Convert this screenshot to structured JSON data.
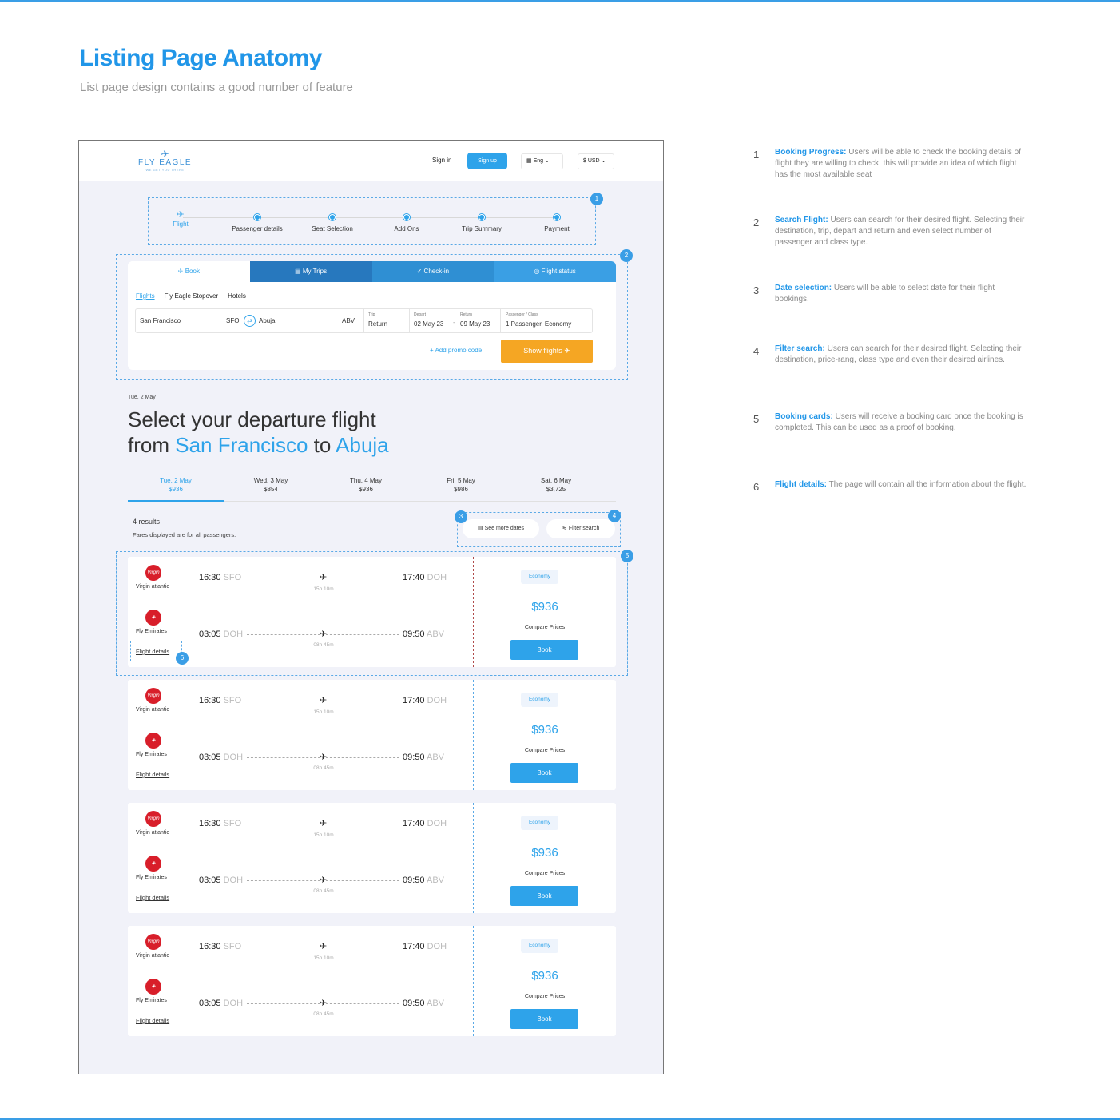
{
  "header": {
    "title": "Listing Page Anatomy",
    "subtitle": "List page design contains a good number of feature"
  },
  "nav": {
    "brand": "FLY EAGLE",
    "tagline": "WE GET YOU THERE",
    "sign_in": "Sign in",
    "sign_up": "Sign up",
    "language": "Eng",
    "currency": "$ USD"
  },
  "progress": {
    "steps": [
      "Flight",
      "Passenger details",
      "Seat Selection",
      "Add Ons",
      "Trip Summary",
      "Payment"
    ]
  },
  "search": {
    "tabs": [
      "Book",
      "My Trips",
      "Check-in",
      "Flight status"
    ],
    "subtabs": [
      "Flights",
      "Fly Eagle Stopover",
      "Hotels"
    ],
    "from_city": "San Francisco",
    "from_code": "SFO",
    "to_city": "Abuja",
    "to_code": "ABV",
    "trip_label": "Trip",
    "trip_value": "Return",
    "depart_label": "Depart",
    "depart_value": "02 May 23",
    "return_label": "Return",
    "return_value": "09 May 23",
    "pax_label": "Passenger / Class",
    "pax_value": "1 Passenger, Economy",
    "promo": "+ Add promo code",
    "show_flights": "Show flights"
  },
  "listing": {
    "date": "Tue, 2 May",
    "heading_line1": "Select your departure flight",
    "heading_from": "from",
    "heading_origin": "San Francisco",
    "heading_to": "to",
    "heading_dest": "Abuja",
    "date_tabs": [
      {
        "day": "Tue, 2 May",
        "price": "$936"
      },
      {
        "day": "Wed, 3 May",
        "price": "$854"
      },
      {
        "day": "Thu, 4 May",
        "price": "$936"
      },
      {
        "day": "Fri, 5 May",
        "price": "$986"
      },
      {
        "day": "Sat, 6 May",
        "price": "$3,725"
      }
    ],
    "results": "4 results",
    "fares_note": "Fares displayed are for all passengers.",
    "see_more_dates": "See more dates",
    "filter_search": "Filter search"
  },
  "card": {
    "airline1": "Virgin atlantic",
    "airline2": "Fly Emirates",
    "logo_text": "Virgin",
    "dep1_time": "16:30",
    "dep1_code": "SFO",
    "arr1_time": "17:40",
    "arr1_code": "DOH",
    "dur1": "15h 10m",
    "dep2_time": "03:05",
    "dep2_code": "DOH",
    "arr2_time": "09:50",
    "arr2_code": "ABV",
    "dur2": "08h 45m",
    "flight_details": "Flight details",
    "class": "Economy",
    "price": "$936",
    "compare": "Compare Prices",
    "book": "Book"
  },
  "badges": [
    "1",
    "2",
    "3",
    "4",
    "5",
    "6"
  ],
  "notes": [
    {
      "num": "1",
      "title": "Booking Progress:",
      "text": " Users will be able to check the booking details of flight they are willing to check. this will provide an idea of which flight has the most available seat"
    },
    {
      "num": "2",
      "title": "Search Flight:",
      "text": " Users can search for their desired flight. Selecting their destination, trip, depart and return and even select number of passenger and class type."
    },
    {
      "num": "3",
      "title": "Date selection:",
      "text": " Users will be able to select date for their flight bookings."
    },
    {
      "num": "4",
      "title": "Filter search:",
      "text": " Users can search for their desired flight. Selecting their destination, price-rang, class type and even their desired airlines."
    },
    {
      "num": "5",
      "title": "Booking cards:",
      "text": " Users will receive a booking card once the booking is completed. This can be used as a proof of booking."
    },
    {
      "num": "6",
      "title": "Flight details:",
      "text": " The page will contain all the information about the flight."
    }
  ],
  "colors": {
    "accent": "#2196e8",
    "cta": "#f5a623",
    "airline_red": "#d81e2a"
  }
}
